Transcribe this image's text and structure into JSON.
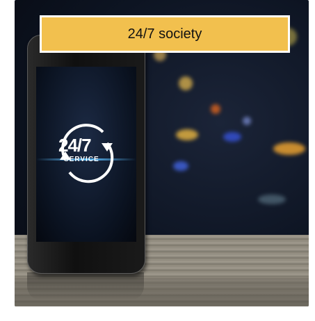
{
  "caption": {
    "text": "24/7 society"
  },
  "phone_screen": {
    "headline": "24/7",
    "subline": "SERVICE"
  },
  "colors": {
    "banner": "#f2c04e",
    "banner_border": "#ffffff",
    "screen_glow": "#5abeff"
  },
  "icons": {
    "clock_arrows": "circular-arrows-icon"
  }
}
